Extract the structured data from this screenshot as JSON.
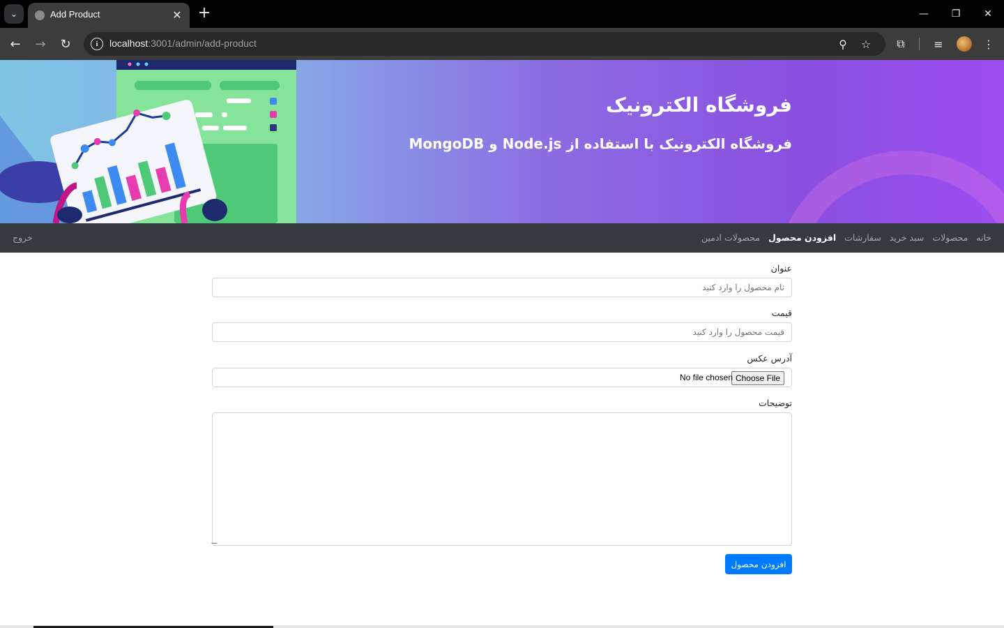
{
  "browser": {
    "tab_title": "Add Product",
    "url_host": "localhost",
    "url_path": ":3001/admin/add-product"
  },
  "hero": {
    "title": "فروشگاه الکترونیک",
    "subtitle": "فروشگاه الکترونیک با استفاده از Node.js و MongoDB"
  },
  "navbar": {
    "links": [
      {
        "label": "خانه",
        "active": false
      },
      {
        "label": "محصولات",
        "active": false
      },
      {
        "label": "سبد خرید",
        "active": false
      },
      {
        "label": "سفارشات",
        "active": false
      },
      {
        "label": "افزودن محصول",
        "active": true
      },
      {
        "label": "محصولات ادمین",
        "active": false
      }
    ],
    "logout": "خروج"
  },
  "form": {
    "title_label": "عنوان",
    "title_placeholder": "نام محصول را وارد کنید",
    "price_label": "قیمت",
    "price_placeholder": "قیمت محصول را وارد کنید",
    "image_label": "آدرس عکس",
    "file_button": "Choose File",
    "file_status": "No file chosen",
    "description_label": "توضیحات",
    "submit_label": "افزودن محصول"
  },
  "colors": {
    "navbar": "#343a40",
    "primary": "#007bff"
  }
}
